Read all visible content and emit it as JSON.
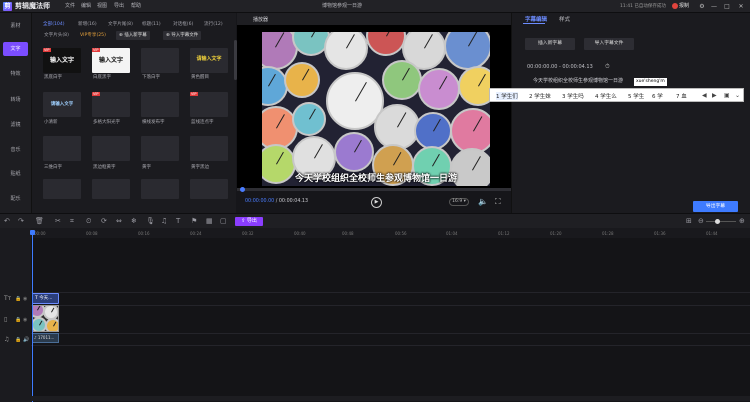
{
  "app": {
    "logo_letter": "剪",
    "name": "剪辑魔法师",
    "menus": [
      "文件",
      "编辑",
      "视图",
      "导出",
      "帮助"
    ],
    "window_title": "博物馆参观一日游",
    "save_status": "11:41 已自动保存成功",
    "upgrade_label": "报制"
  },
  "left_nav": [
    "素材",
    "文字",
    "特效",
    "转场",
    "滤镜",
    "音乐",
    "贴纸",
    "配乐"
  ],
  "library": {
    "tabs": [
      "全部(104)",
      "新增(16)",
      "文字片尾(8)",
      "标题(11)",
      "对话框(6)",
      "流行(12)"
    ],
    "sub_tabs": [
      "文字片头(8)",
      "VIP专享(25)"
    ],
    "add_subtitle_btn": "插入新字幕",
    "import_subtitle_btn": "导入字幕文件",
    "tiles": [
      {
        "label": "黑底白字",
        "text": "输入文字",
        "vip": true
      },
      {
        "label": "白底黑字",
        "text": "输入文字",
        "vip": true
      },
      {
        "label": "下落白字",
        "text": "",
        "vip": false
      },
      {
        "label": "黄色醒目",
        "text": "请输入文字",
        "vip": false
      },
      {
        "label": "小清新",
        "text": "请输入文字",
        "vip": false
      },
      {
        "label": "多格大阳光字",
        "text": "",
        "vip": true
      },
      {
        "label": "横线发布字",
        "text": "",
        "vip": false
      },
      {
        "label": "蓝线连点字",
        "text": "",
        "vip": true
      },
      {
        "label": "三维白字",
        "text": "",
        "vip": false
      },
      {
        "label": "黑边框黄字",
        "text": "",
        "vip": false
      },
      {
        "label": "黄字",
        "text": "",
        "vip": false
      },
      {
        "label": "黄字黑边",
        "text": "",
        "vip": false
      }
    ],
    "vip_tag": "VIP"
  },
  "player": {
    "label": "播放器",
    "subtitle": "今天学校组织全校师生参观博物馆一日游",
    "current_time": "00:00:00.00",
    "total_time": "00:00:04.13",
    "ratio": "16:9"
  },
  "right_panel": {
    "tabs": [
      "字幕编辑",
      "样式"
    ],
    "insert_btn": "插入新字幕",
    "import_btn": "导入字幕文件",
    "time_range": "00:00:00.00 - 00:00:04.13",
    "subtitle_text": "今天学校组织全校师生参观博物馆一日游",
    "ime_composition": "xue'sheng'm",
    "ime_candidates": [
      "1 学生们",
      "2 学生妹",
      "3 学生吗",
      "4 学生么",
      "5 学生",
      "6 学",
      "7 血"
    ],
    "export_subtitle_btn": "导出字幕"
  },
  "toolbar": {
    "export_label": "导出"
  },
  "timeline": {
    "ruler": [
      "00:00",
      "00:08",
      "00:16",
      "00:24",
      "00:32",
      "00:40",
      "00:48",
      "00:56",
      "01:04",
      "01:12",
      "01:20",
      "01:28",
      "01:36",
      "01:44"
    ],
    "text_clip": "今天...",
    "audio_clip": "17011..."
  },
  "colors": {
    "accent_blue": "#3e7bff",
    "accent_purple": "#7b4dff",
    "vip_red": "#e23b3b"
  }
}
